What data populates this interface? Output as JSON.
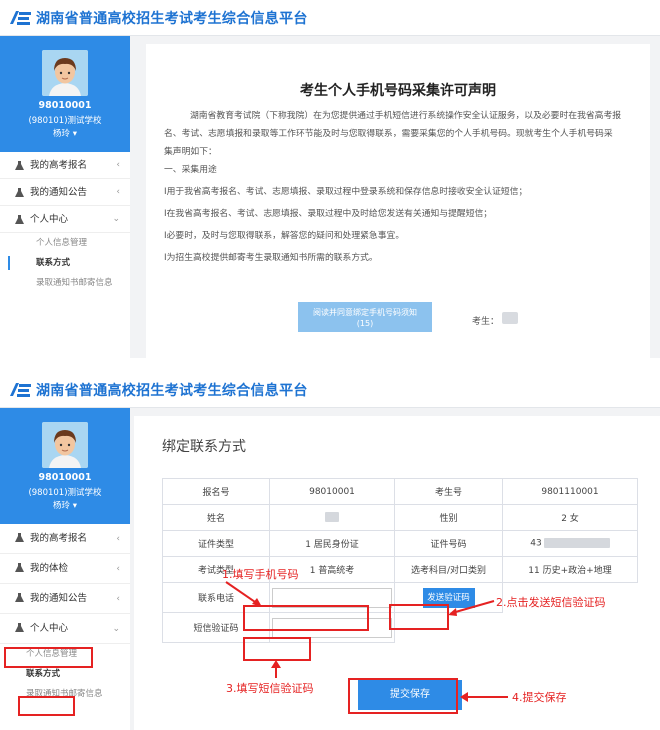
{
  "site_title": "湖南省普通高校招生考试考生综合信息平台",
  "profile": {
    "id": "98010001",
    "school": "(980101)测试学校",
    "name": "杨玲"
  },
  "top_menu": {
    "gaokao": "我的高考报名",
    "notice": "我的通知公告",
    "personal": "个人中心",
    "sub": [
      "个人信息管理",
      "联系方式",
      "录取通知书邮寄信息"
    ]
  },
  "bottom_menu": {
    "gaokao": "我的高考报名",
    "physical": "我的体检",
    "notice": "我的通知公告",
    "personal": "个人中心",
    "sub": [
      "个人信息管理",
      "联系方式",
      "录取通知书邮寄信息"
    ]
  },
  "statement": {
    "title": "考生个人手机号码采集许可声明",
    "lines": [
      "湖南省教育考试院（下称我院）在为您提供通过手机短信进行系统操作安全认证服务，以及必要时在我省高考报",
      "名、考试、志愿填报和录取等工作环节能及时与您取得联系，需要采集您的个人手机号码。现就考生个人手机号码采",
      "集声明如下：",
      "一、采集用途",
      "Ⅰ用于我省高考报名、考试、志愿填报、录取过程中登录系统和保存信息时接收安全认证短信；",
      "Ⅰ在我省高考报名、考试、志愿填报、录取过程中及时给您发送有关通知与提醒短信；",
      "Ⅰ必要时，及时与您取得联系，解答您的疑问和处理紧急事宜。",
      "Ⅰ为招生高校提供邮寄考生录取通知书所需的联系方式。"
    ],
    "agree_button": "阅读并同意绑定手机号码须知",
    "countdown": "(15)",
    "examinee_label": "考生："
  },
  "bind": {
    "title": "绑定联系方式",
    "labels": {
      "reg_no": "报名号",
      "exam_no": "考生号",
      "name": "姓名",
      "gender": "性别",
      "id_type": "证件类型",
      "id_no": "证件号码",
      "exam_type": "考试类型",
      "subject": "选考科目/对口类别",
      "phone": "联系电话",
      "sms_code": "短信验证码"
    },
    "values": {
      "reg_no": "98010001",
      "exam_no": "9801110001",
      "gender": "2 女",
      "id_type": "1 居民身份证",
      "id_no_prefix": "43",
      "exam_type": "1 普高统考",
      "subject": "11 历史+政治+地理"
    },
    "send_sms_button": "发送验证码",
    "submit_button": "提交保存"
  },
  "annotations": {
    "step1": "1.填写手机号码",
    "step2": "2.点击发送短信验证码",
    "step3": "3.填写短信验证码",
    "step4": "4.提交保存"
  },
  "colors": {
    "brand": "#2e8be6",
    "annotation": "#e52222",
    "title": "#1e73d2"
  }
}
